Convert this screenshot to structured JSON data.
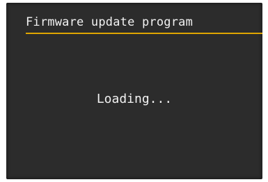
{
  "screen": {
    "title": "Firmware update program",
    "status": "Loading..."
  },
  "colors": {
    "background": "#2c2c2c",
    "text": "#f2f2f2",
    "accent_rule": "#e0a600"
  }
}
